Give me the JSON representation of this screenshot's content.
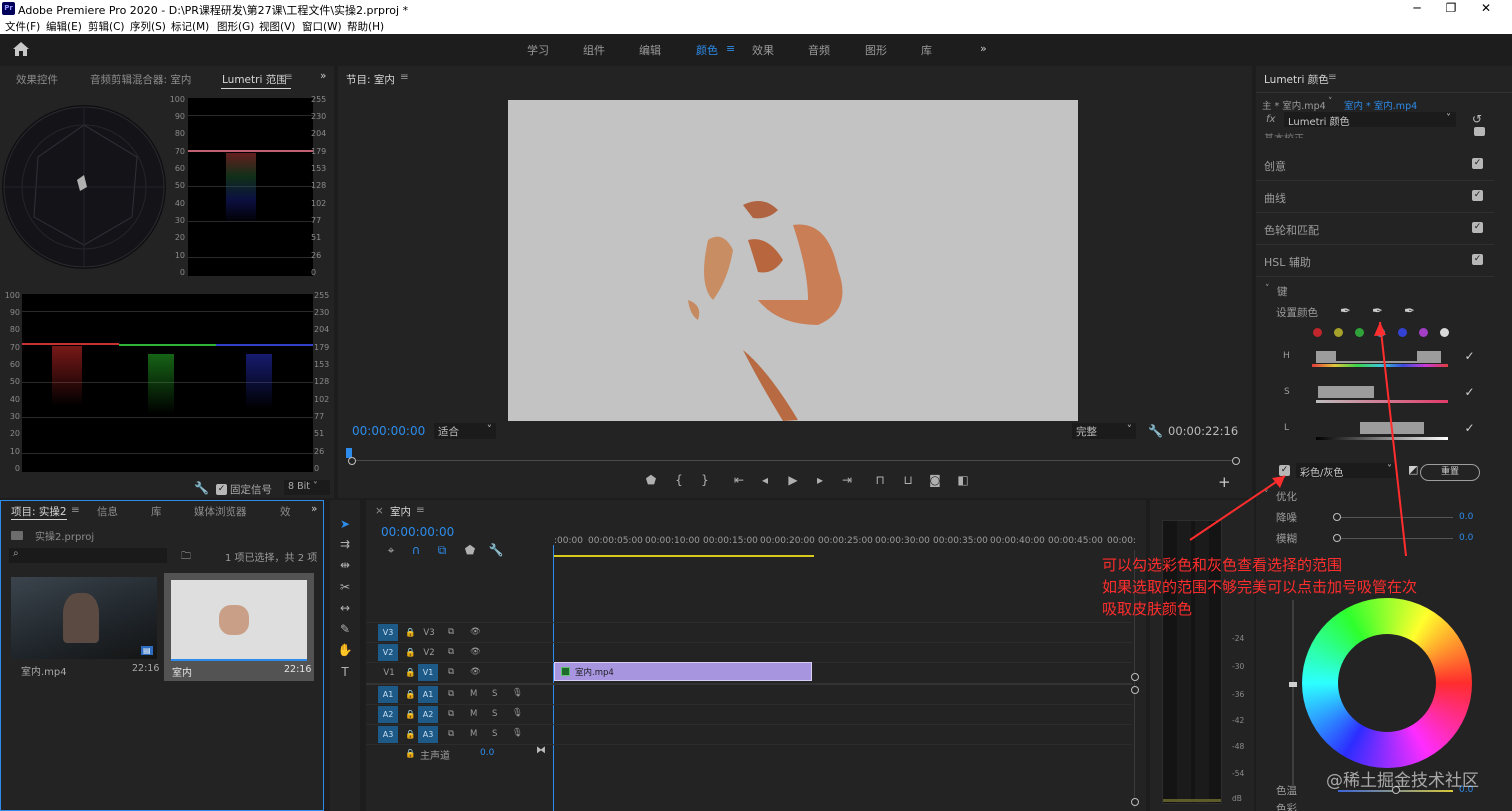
{
  "window": {
    "title": "Adobe Premiere Pro 2020 - D:\\PR课程研发\\第27课\\工程文件\\实操2.prproj *",
    "app_badge": "Pr"
  },
  "menu": [
    "文件(F)",
    "编辑(E)",
    "剪辑(C)",
    "序列(S)",
    "标记(M)",
    "图形(G)",
    "视图(V)",
    "窗口(W)",
    "帮助(H)"
  ],
  "workspaces": [
    "学习",
    "组件",
    "编辑",
    "颜色",
    "效果",
    "音频",
    "图形",
    "库"
  ],
  "active_workspace": "颜色",
  "source_panel": {
    "tabs": [
      "效果控件",
      "音频剪辑混合器: 室内",
      "Lumetri 范围"
    ],
    "active_tab": "Lumetri 范围",
    "scale_left": [
      "100",
      "90",
      "80",
      "70",
      "60",
      "50",
      "40",
      "30",
      "20",
      "10",
      "0"
    ],
    "scale_right": [
      "255",
      "230",
      "204",
      "179",
      "153",
      "128",
      "102",
      "77",
      "51",
      "26",
      "0"
    ],
    "clamp_label": "固定信号",
    "bitdepth": "8 Bit"
  },
  "program": {
    "title": "节目: 室内",
    "timecode": "00:00:00:00",
    "fit": "适合",
    "quality": "完整",
    "duration": "00:00:22:16"
  },
  "project": {
    "tabs": [
      "项目: 实操2",
      "信息",
      "库",
      "媒体浏览器",
      "效"
    ],
    "file": "实操2.prproj",
    "selection_info": "1 项已选择，共 2 项",
    "items": [
      {
        "name": "室内.mp4",
        "duration": "22:16"
      },
      {
        "name": "室内",
        "duration": "22:16"
      }
    ]
  },
  "timeline": {
    "title": "室内",
    "timecode": "00:00:00:00",
    "ruler": [
      ":00:00",
      "00:00:05:00",
      "00:00:10:00",
      "00:00:15:00",
      "00:00:20:00",
      "00:00:25:00",
      "00:00:30:00",
      "00:00:35:00",
      "00:00:40:00",
      "00:00:45:00",
      "00:00:"
    ],
    "video_tracks": [
      "V3",
      "V2",
      "V1"
    ],
    "audio_tracks": [
      "A1",
      "A2",
      "A3"
    ],
    "mute": "M",
    "solo": "S",
    "master_label": "主声道",
    "master_value": "0.0",
    "clip_name": "室内.mp4",
    "meter_scale": [
      "-24",
      "-30",
      "-36",
      "-42",
      "-48",
      "-54",
      "dB"
    ]
  },
  "lumetri": {
    "title": "Lumetri 颜色",
    "source_label": "主 * 室内.mp4",
    "target_label": "室内 * 室内.mp4",
    "fx_label": "fx",
    "effect_name": "Lumetri 颜色",
    "partial_section": "基本校正",
    "sections": [
      "创意",
      "曲线",
      "色轮和匹配",
      "HSL 辅助"
    ],
    "key_section": "键",
    "set_color_label": "设置颜色",
    "hsl_labels": [
      "H",
      "S",
      "L"
    ],
    "color_gray_label": "彩色/灰色",
    "reset_label": "重置",
    "refine_section": "优化",
    "refine": [
      {
        "label": "降噪",
        "value": "0.0"
      },
      {
        "label": "模糊",
        "value": "0.0"
      }
    ],
    "temp_label": "色温",
    "temp_value": "0.0",
    "tint_label": "色彩",
    "swatch_colors": [
      "#c0262b",
      "#a6a12a",
      "#2fa33a",
      "#27a0c4",
      "#3442d3",
      "#a23fc5",
      "#d8d8d8"
    ]
  },
  "annotation": {
    "line1": "可以勾选彩色和灰色查看选择的范围",
    "line2": "如果选取的范围不够完美可以点击加号吸管在次",
    "line3": "吸取皮肤颜色",
    "color": "#ff2d2d"
  },
  "watermark": "@稀土掘金技术社区"
}
